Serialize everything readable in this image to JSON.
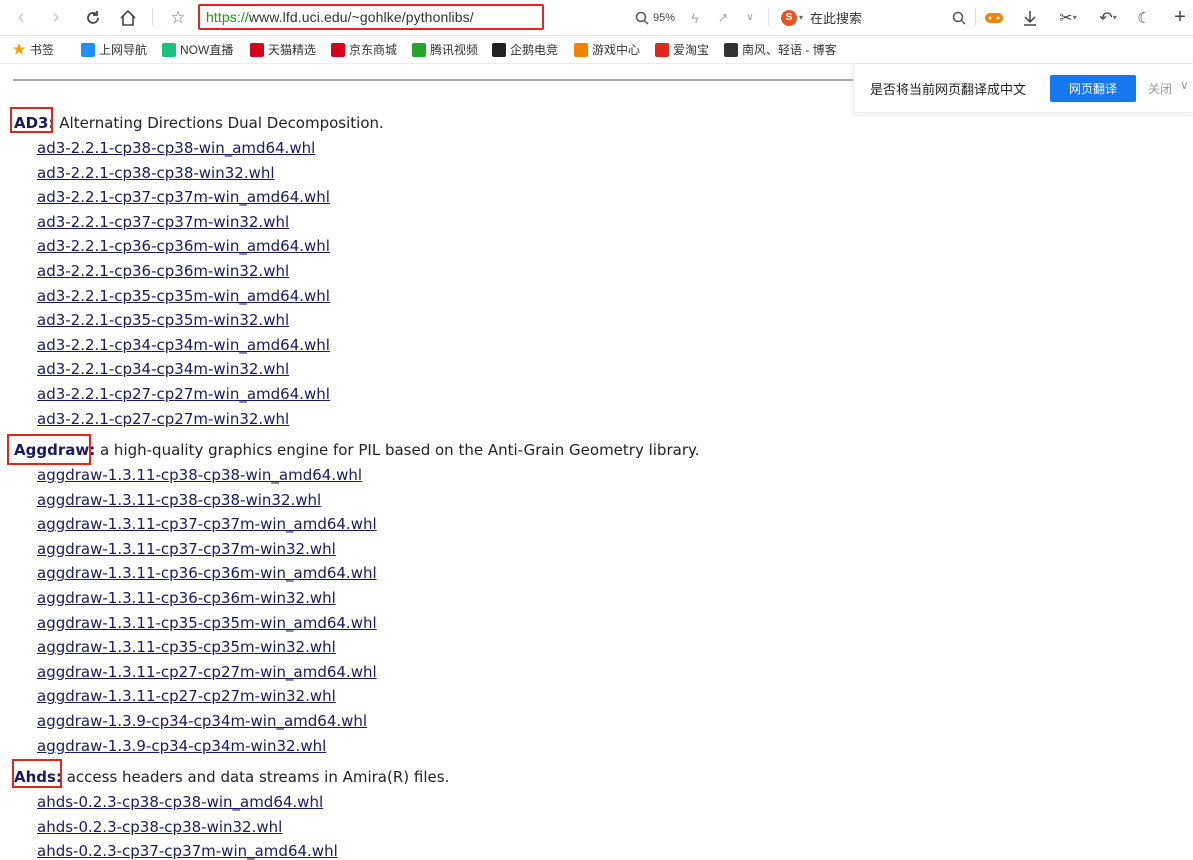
{
  "address_bar": {
    "scheme": "https://",
    "rest": "www.lfd.uci.edu/~gohlke/pythonlibs/"
  },
  "toolbar": {
    "zoom": "95%",
    "search_label": "在此搜索"
  },
  "bookmarks": [
    {
      "label": "书签",
      "icon": "star-icon",
      "color": "#f0a000"
    },
    {
      "label": "上网导航",
      "icon": "e-icon",
      "color": "#1e90ff"
    },
    {
      "label": "NOW直播",
      "icon": "now-icon",
      "color": "#19c37d"
    },
    {
      "label": "天猫精选",
      "icon": "tmall-icon",
      "color": "#d4001a"
    },
    {
      "label": "京东商城",
      "icon": "jd-icon",
      "color": "#d4001a"
    },
    {
      "label": "腾讯视频",
      "icon": "tencent-video-icon",
      "color": "#29a329"
    },
    {
      "label": "企鹅电竞",
      "icon": "penguin-icon",
      "color": "#222"
    },
    {
      "label": "游戏中心",
      "icon": "gamepad-icon",
      "color": "#f08300"
    },
    {
      "label": "爱淘宝",
      "icon": "taobao-icon",
      "color": "#e0261d"
    },
    {
      "label": "南风、轻语 - 博客",
      "icon": "blog-icon",
      "color": "#333"
    }
  ],
  "translate": {
    "message": "是否将当前网页翻译成中文",
    "button": "网页翻译",
    "close": "关闭"
  },
  "sections": [
    {
      "name": "AD3:",
      "desc": " Alternating Directions Dual Decomposition.",
      "files": [
        "ad3-2.2.1-cp38-cp38-win_amd64.whl",
        "ad3-2.2.1-cp38-cp38-win32.whl",
        "ad3-2.2.1-cp37-cp37m-win_amd64.whl",
        "ad3-2.2.1-cp37-cp37m-win32.whl",
        "ad3-2.2.1-cp36-cp36m-win_amd64.whl",
        "ad3-2.2.1-cp36-cp36m-win32.whl",
        "ad3-2.2.1-cp35-cp35m-win_amd64.whl",
        "ad3-2.2.1-cp35-cp35m-win32.whl",
        "ad3-2.2.1-cp34-cp34m-win_amd64.whl",
        "ad3-2.2.1-cp34-cp34m-win32.whl",
        "ad3-2.2.1-cp27-cp27m-win_amd64.whl",
        "ad3-2.2.1-cp27-cp27m-win32.whl"
      ]
    },
    {
      "name": "Aggdraw:",
      "desc": " a high-quality graphics engine for PIL based on the Anti-Grain Geometry library.",
      "files": [
        "aggdraw-1.3.11-cp38-cp38-win_amd64.whl",
        "aggdraw-1.3.11-cp38-cp38-win32.whl",
        "aggdraw-1.3.11-cp37-cp37m-win_amd64.whl",
        "aggdraw-1.3.11-cp37-cp37m-win32.whl",
        "aggdraw-1.3.11-cp36-cp36m-win_amd64.whl",
        "aggdraw-1.3.11-cp36-cp36m-win32.whl",
        "aggdraw-1.3.11-cp35-cp35m-win_amd64.whl",
        "aggdraw-1.3.11-cp35-cp35m-win32.whl",
        "aggdraw-1.3.11-cp27-cp27m-win_amd64.whl",
        "aggdraw-1.3.11-cp27-cp27m-win32.whl",
        "aggdraw-1.3.9-cp34-cp34m-win_amd64.whl",
        "aggdraw-1.3.9-cp34-cp34m-win32.whl"
      ]
    },
    {
      "name": "Ahds:",
      "desc": " access headers and data streams in Amira(R) files.",
      "files": [
        "ahds-0.2.3-cp38-cp38-win_amd64.whl",
        "ahds-0.2.3-cp38-cp38-win32.whl",
        "ahds-0.2.3-cp37-cp37m-win_amd64.whl"
      ]
    }
  ]
}
